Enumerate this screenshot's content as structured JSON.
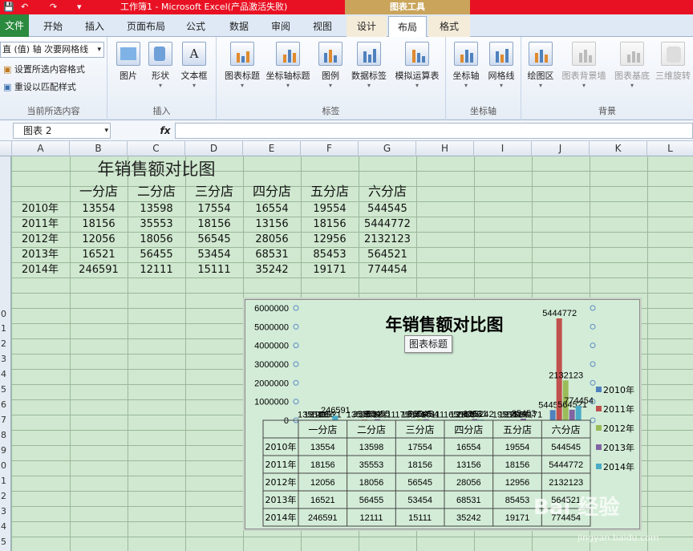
{
  "window": {
    "app_title": "工作簿1 - Microsoft Excel(产品激活失败)",
    "context_tools": "图表工具"
  },
  "tabs": [
    {
      "label": "文件"
    },
    {
      "label": "开始"
    },
    {
      "label": "插入"
    },
    {
      "label": "页面布局"
    },
    {
      "label": "公式"
    },
    {
      "label": "数据"
    },
    {
      "label": "审阅"
    },
    {
      "label": "视图"
    },
    {
      "label": "设计"
    },
    {
      "label": "布局"
    },
    {
      "label": "格式"
    }
  ],
  "ribbon": {
    "current_selection": {
      "dropdown": "直 (值) 轴 次要网格线",
      "format_selection": "设置所选内容格式",
      "reset_style": "重设以匹配样式",
      "label": "当前所选内容"
    },
    "insert": {
      "label": "插入",
      "buttons": [
        "图片",
        "形状",
        "文本框"
      ]
    },
    "labels": {
      "label": "标签",
      "buttons": [
        "图表标题",
        "坐标轴标题",
        "图例",
        "数据标签",
        "模拟运算表"
      ]
    },
    "axes": {
      "label": "坐标轴",
      "buttons": [
        "坐标轴",
        "网格线"
      ]
    },
    "background": {
      "label": "背景",
      "buttons": [
        "绘图区",
        "图表背景墙",
        "图表基底",
        "三维旋转"
      ]
    }
  },
  "formula_bar": {
    "name_box": "图表 2",
    "fx": "fx"
  },
  "columns": [
    "A",
    "B",
    "C",
    "D",
    "E",
    "F",
    "G",
    "H",
    "I",
    "J",
    "K",
    "L"
  ],
  "row_numbers": [
    "0",
    "1",
    "2",
    "3",
    "4",
    "5",
    "6",
    "7",
    "8",
    "9",
    "0",
    "1",
    "2",
    "3",
    "4",
    "5"
  ],
  "sheet": {
    "title": "年销售额对比图",
    "stores": [
      "一分店",
      "二分店",
      "三分店",
      "四分店",
      "五分店",
      "六分店"
    ],
    "rows": [
      {
        "year": "2010年",
        "values": [
          "13554",
          "13598",
          "17554",
          "16554",
          "19554",
          "544545"
        ]
      },
      {
        "year": "2011年",
        "values": [
          "18156",
          "35553",
          "18156",
          "13156",
          "18156",
          "5444772"
        ]
      },
      {
        "year": "2012年",
        "values": [
          "12056",
          "18056",
          "56545",
          "28056",
          "12956",
          "2132123"
        ]
      },
      {
        "year": "2013年",
        "values": [
          "16521",
          "56455",
          "53454",
          "68531",
          "85453",
          "564521"
        ]
      },
      {
        "year": "2014年",
        "values": [
          "246591",
          "12111",
          "15111",
          "35242",
          "19171",
          "774454"
        ]
      }
    ]
  },
  "tooltip": "图表标题",
  "watermark": {
    "text": "Bai 经验",
    "url": "jingyan.baidu.com"
  },
  "chart_data": {
    "type": "bar",
    "title": "年销售额对比图",
    "categories": [
      "一分店",
      "二分店",
      "三分店",
      "四分店",
      "五分店",
      "六分店"
    ],
    "y_ticks": [
      "6000000",
      "5000000",
      "4000000",
      "3000000",
      "2000000",
      "1000000",
      "0"
    ],
    "ylim": [
      0,
      6000000
    ],
    "legend_position": "right",
    "data_table": true,
    "series": [
      {
        "name": "2010年",
        "color": "#4f81bd",
        "values": [
          13554,
          13598,
          17554,
          16554,
          19554,
          544545
        ]
      },
      {
        "name": "2011年",
        "color": "#c0504d",
        "values": [
          18156,
          35553,
          18156,
          13156,
          18156,
          5444772
        ]
      },
      {
        "name": "2012年",
        "color": "#9bbb59",
        "values": [
          12056,
          18056,
          56545,
          28056,
          12956,
          2132123
        ]
      },
      {
        "name": "2013年",
        "color": "#8064a2",
        "values": [
          16521,
          56455,
          53454,
          68531,
          85453,
          564521
        ]
      },
      {
        "name": "2014年",
        "color": "#4bacc6",
        "values": [
          246591,
          12111,
          15111,
          35242,
          19171,
          774454
        ]
      }
    ]
  }
}
